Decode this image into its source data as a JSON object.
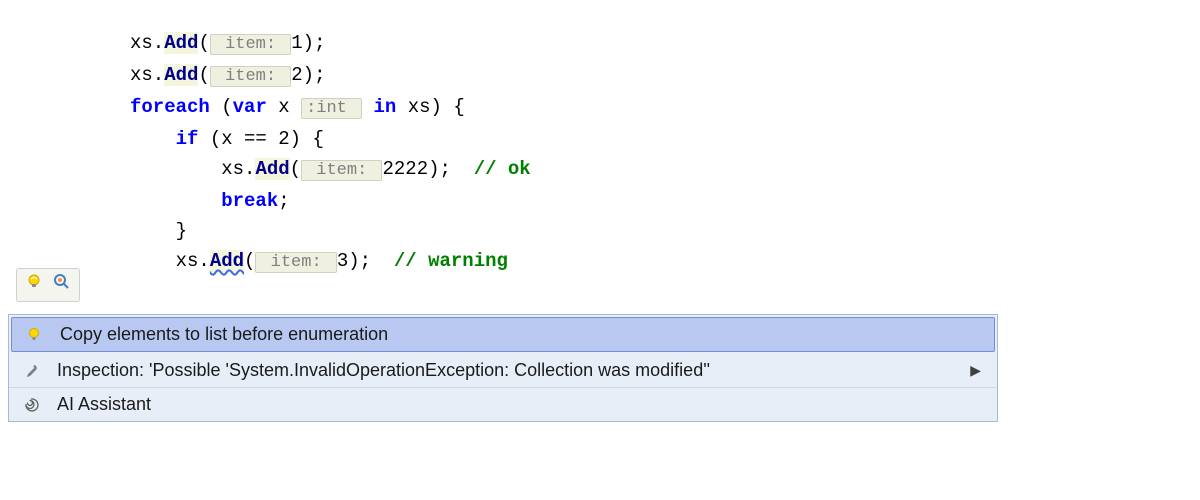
{
  "code": {
    "line1": {
      "prefix": "xs.",
      "method": "Add",
      "paren_open": "(",
      "hint": " item: ",
      "value": "1",
      "paren_close": ");"
    },
    "line2": {
      "prefix": "xs.",
      "method": "Add",
      "paren_open": "(",
      "hint": " item: ",
      "value": "2",
      "paren_close": ");"
    },
    "line3": {
      "kw1": "foreach",
      "space1": " (",
      "kw2": "var",
      "space2": " x ",
      "hint": ":int ",
      "kw3": " in",
      "rest": " xs) {"
    },
    "line4": {
      "indent": "    ",
      "kw": "if",
      "rest": " (x == 2) {"
    },
    "line5": {
      "indent": "        ",
      "prefix": "xs.",
      "method": "Add",
      "paren_open": "(",
      "hint": " item: ",
      "value": "2222",
      "paren_close": ");  ",
      "comment": "// ok"
    },
    "line6": {
      "indent": "        ",
      "kw": "break",
      "rest": ";"
    },
    "line7": {
      "indent": "    }",
      "rest": ""
    },
    "line8": {
      "indent": "    ",
      "prefix": "xs.",
      "method": "Add",
      "paren_open": "(",
      "hint": " item: ",
      "value": "3",
      "paren_close": ");  ",
      "comment": "// warning"
    }
  },
  "popup": {
    "item1": "Copy elements to list before enumeration",
    "item2": "Inspection: 'Possible 'System.InvalidOperationException: Collection was modified''",
    "item3": "AI Assistant"
  }
}
